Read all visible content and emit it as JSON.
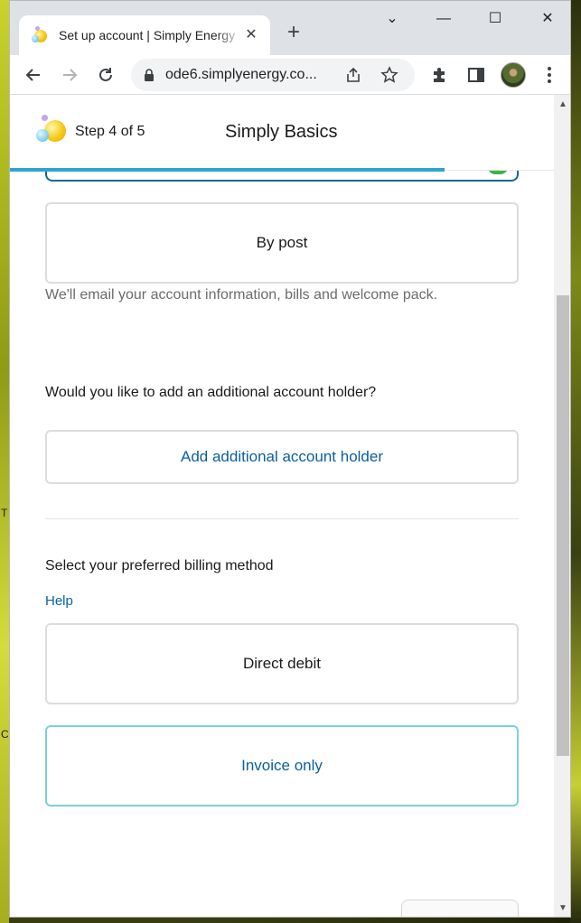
{
  "browser": {
    "tab_title": "Set up account | Simply Energy",
    "tab_close": "✕",
    "new_tab": "+",
    "url": "ode6.simplyenergy.co...",
    "window_controls": {
      "collapse": "⌄",
      "minimize": "—",
      "maximize": "☐",
      "close": "✕"
    }
  },
  "header": {
    "step": "Step 4 of 5",
    "plan": "Simply Basics"
  },
  "delivery": {
    "by_post": "By post",
    "note": "We'll email your account information, bills and welcome pack."
  },
  "account_holder": {
    "question": "Would you like to add an additional account holder?",
    "add_button": "Add additional account holder"
  },
  "billing": {
    "question": "Select your preferred billing method",
    "help": "Help",
    "options": [
      "Direct debit",
      "Invoice only"
    ]
  },
  "colors": {
    "accent": "#2ea3d4",
    "link": "#0b5fa0",
    "selected_border": "#0b6a93"
  },
  "desktop": {
    "edge_text_1": "T",
    "edge_text_2": "C"
  }
}
